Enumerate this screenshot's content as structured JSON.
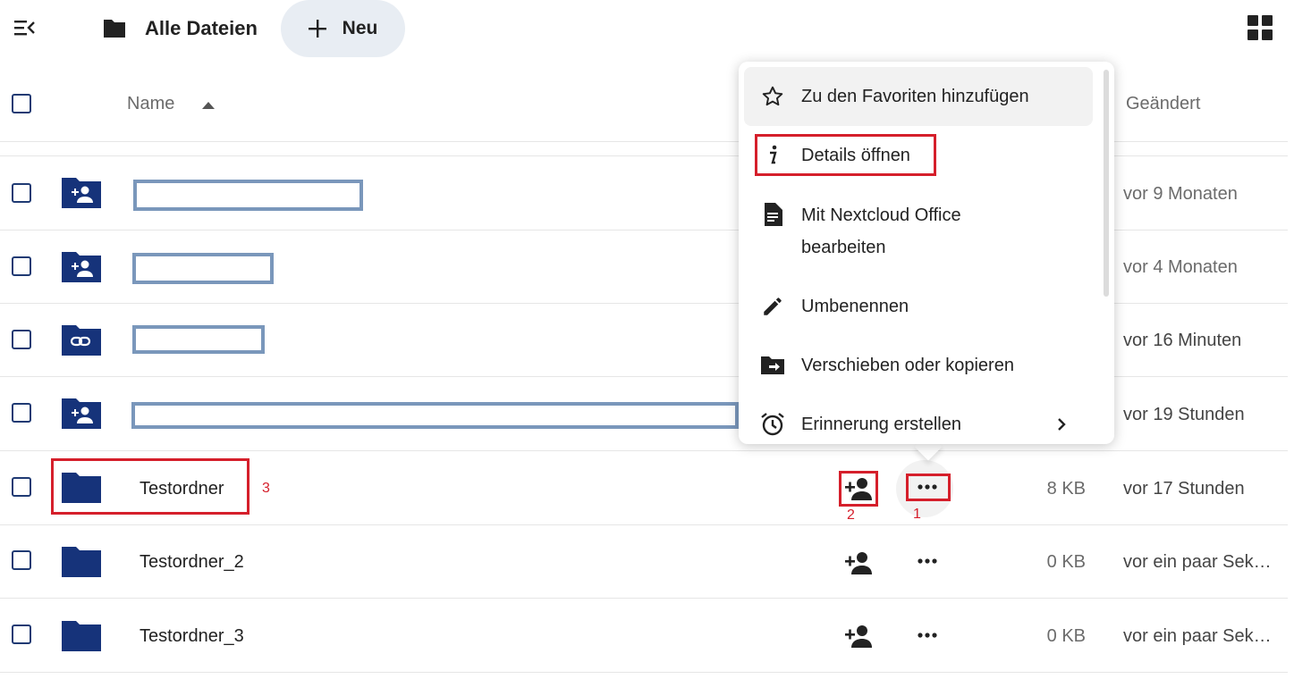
{
  "header": {
    "breadcrumb_label": "Alle Dateien",
    "new_button_label": "Neu"
  },
  "columns": {
    "name": "Name",
    "modified": "Geändert"
  },
  "rows": [
    {
      "name": "",
      "icon": "shared-folder-icon",
      "size": "",
      "modified": "vor 9 Monaten"
    },
    {
      "name": "",
      "icon": "shared-folder-icon",
      "size": "",
      "modified": "vor 4 Monaten"
    },
    {
      "name": "",
      "icon": "link-folder-icon",
      "size": "",
      "modified": "vor 16 Minuten"
    },
    {
      "name": "",
      "icon": "shared-folder-icon",
      "size": "",
      "modified": "vor 19 Stunden"
    },
    {
      "name": "Testordner",
      "icon": "folder-icon",
      "size": "8 KB",
      "modified": "vor 17 Stunden"
    },
    {
      "name": "Testordner_2",
      "icon": "folder-icon",
      "size": "0 KB",
      "modified": "vor ein paar Sekunden"
    },
    {
      "name": "Testordner_3",
      "icon": "folder-icon",
      "size": "0 KB",
      "modified": "vor ein paar Sekunden"
    }
  ],
  "menu": {
    "items": [
      {
        "label": "Zu den Favoriten hinzufügen",
        "icon": "star-icon"
      },
      {
        "label": "Details öffnen",
        "icon": "info-icon"
      },
      {
        "label_line1": "Mit Nextcloud Office",
        "label_line2": "bearbeiten",
        "icon": "document-icon"
      },
      {
        "label": "Umbenennen",
        "icon": "pencil-icon"
      },
      {
        "label": "Verschieben oder kopieren",
        "icon": "folder-move-icon"
      },
      {
        "label": "Erinnerung erstellen",
        "icon": "alarm-clock-icon"
      }
    ]
  },
  "annotations": {
    "actions_marker": "1",
    "share_marker": "2",
    "name_marker": "3"
  },
  "colors": {
    "folder": "#16337a",
    "highlight": "#d51f2b",
    "redaction": "#7a97bb"
  }
}
